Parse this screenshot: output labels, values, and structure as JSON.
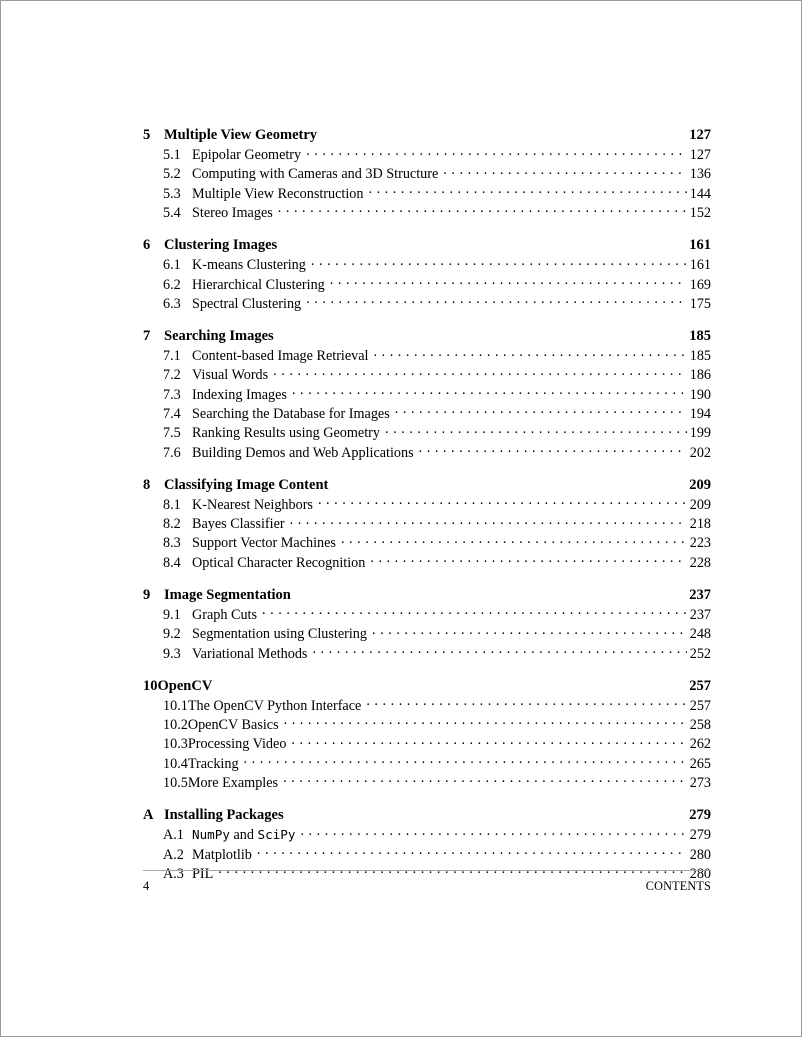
{
  "document": {
    "running_head": "CONTENTS",
    "folio": "4"
  },
  "toc": {
    "entries": [
      {
        "kind": "chapter",
        "number": "5",
        "title": "Multiple View Geometry",
        "page": "127",
        "tight": false
      },
      {
        "kind": "section",
        "number": "5.1",
        "title": "Epipolar Geometry",
        "page": "127",
        "tight": false
      },
      {
        "kind": "section",
        "number": "5.2",
        "title": "Computing with Cameras and 3D Structure",
        "page": "136",
        "tight": false
      },
      {
        "kind": "section",
        "number": "5.3",
        "title": "Multiple View Reconstruction",
        "page": "144",
        "tight": false
      },
      {
        "kind": "section",
        "number": "5.4",
        "title": "Stereo Images",
        "page": "152",
        "tight": false
      },
      {
        "kind": "chapter",
        "number": "6",
        "title": "Clustering Images",
        "page": "161",
        "tight": false
      },
      {
        "kind": "section",
        "number": "6.1",
        "title": "K-means Clustering",
        "page": "161",
        "tight": false
      },
      {
        "kind": "section",
        "number": "6.2",
        "title": "Hierarchical Clustering",
        "page": "169",
        "tight": false
      },
      {
        "kind": "section",
        "number": "6.3",
        "title": "Spectral Clustering",
        "page": "175",
        "tight": false
      },
      {
        "kind": "chapter",
        "number": "7",
        "title": "Searching Images",
        "page": "185",
        "tight": false
      },
      {
        "kind": "section",
        "number": "7.1",
        "title": "Content-based Image Retrieval",
        "page": "185",
        "tight": false
      },
      {
        "kind": "section",
        "number": "7.2",
        "title": "Visual Words",
        "page": "186",
        "tight": false
      },
      {
        "kind": "section",
        "number": "7.3",
        "title": "Indexing Images",
        "page": "190",
        "tight": false
      },
      {
        "kind": "section",
        "number": "7.4",
        "title": "Searching the Database for Images",
        "page": "194",
        "tight": false
      },
      {
        "kind": "section",
        "number": "7.5",
        "title": "Ranking Results using Geometry",
        "page": "199",
        "tight": false
      },
      {
        "kind": "section",
        "number": "7.6",
        "title": "Building Demos and Web Applications",
        "page": "202",
        "tight": false
      },
      {
        "kind": "chapter",
        "number": "8",
        "title": "Classifying Image Content",
        "page": "209",
        "tight": false
      },
      {
        "kind": "section",
        "number": "8.1",
        "title": "K-Nearest Neighbors",
        "page": "209",
        "tight": false
      },
      {
        "kind": "section",
        "number": "8.2",
        "title": "Bayes Classifier",
        "page": "218",
        "tight": false
      },
      {
        "kind": "section",
        "number": "8.3",
        "title": "Support Vector Machines",
        "page": "223",
        "tight": false
      },
      {
        "kind": "section",
        "number": "8.4",
        "title": "Optical Character Recognition",
        "page": "228",
        "tight": false
      },
      {
        "kind": "chapter",
        "number": "9",
        "title": "Image Segmentation",
        "page": "237",
        "tight": false
      },
      {
        "kind": "section",
        "number": "9.1",
        "title": "Graph Cuts",
        "page": "237",
        "tight": false
      },
      {
        "kind": "section",
        "number": "9.2",
        "title": "Segmentation using Clustering",
        "page": "248",
        "tight": false
      },
      {
        "kind": "section",
        "number": "9.3",
        "title": "Variational Methods",
        "page": "252",
        "tight": false
      },
      {
        "kind": "chapter",
        "number": "10",
        "title": "OpenCV",
        "page": "257",
        "tight": true
      },
      {
        "kind": "section",
        "number": "10.1",
        "title": "The OpenCV Python Interface",
        "page": "257",
        "tight": true
      },
      {
        "kind": "section",
        "number": "10.2",
        "title": "OpenCV Basics",
        "page": "258",
        "tight": true
      },
      {
        "kind": "section",
        "number": "10.3",
        "title": "Processing Video",
        "page": "262",
        "tight": true
      },
      {
        "kind": "section",
        "number": "10.4",
        "title": "Tracking",
        "page": "265",
        "tight": true
      },
      {
        "kind": "section",
        "number": "10.5",
        "title": "More Examples",
        "page": "273",
        "tight": true
      },
      {
        "kind": "chapter",
        "number": "A",
        "title": "Installing Packages",
        "page": "279",
        "tight": false
      },
      {
        "kind": "section",
        "number": "A.1",
        "title": "NumPy and SciPy",
        "title_parts": [
          {
            "text": "NumPy",
            "style": "mono"
          },
          {
            "text": " and ",
            "style": "serif"
          },
          {
            "text": "SciPy",
            "style": "mono"
          }
        ],
        "page": "279",
        "tight": false
      },
      {
        "kind": "section",
        "number": "A.2",
        "title": "Matplotlib",
        "page": "280",
        "tight": false
      },
      {
        "kind": "section",
        "number": "A.3",
        "title": "PIL",
        "page": "280",
        "tight": false
      }
    ]
  }
}
